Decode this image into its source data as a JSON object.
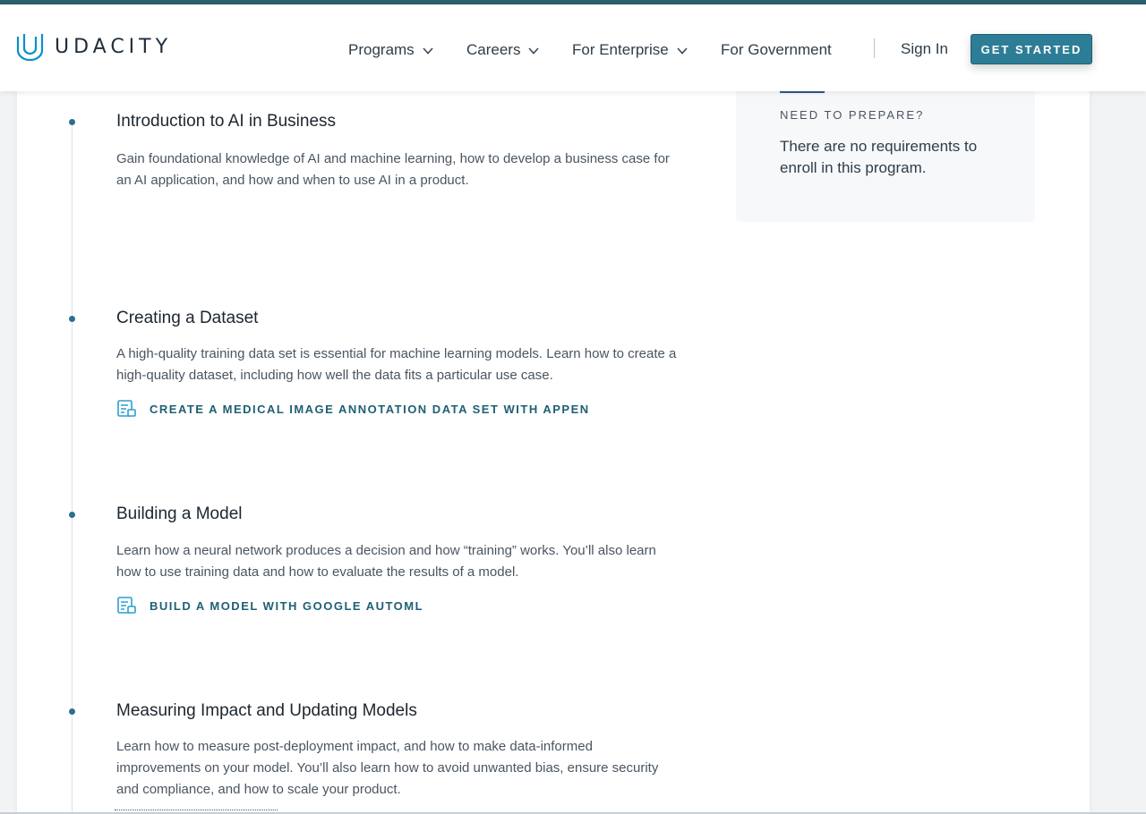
{
  "brand": {
    "name": "UDACITY",
    "accent_color": "#2e7d96",
    "top_strip_color": "#2a5f6e"
  },
  "nav": {
    "items": [
      {
        "label": "Programs",
        "has_dropdown": true
      },
      {
        "label": "Careers",
        "has_dropdown": true
      },
      {
        "label": "For Enterprise",
        "has_dropdown": true
      },
      {
        "label": "For Government",
        "has_dropdown": false
      }
    ],
    "sign_in": "Sign In",
    "cta": "GET STARTED"
  },
  "lessons": [
    {
      "title": "Introduction to AI in Business",
      "description": "Gain foundational knowledge of AI and machine learning, how to develop a business case for an AI application, and how and when to use AI in a product."
    },
    {
      "title": "Creating a Dataset",
      "description": "A high-quality training data set is essential for machine learning models. Learn how to create a high-quality dataset, including how well the data fits a particular use case.",
      "project": "CREATE A MEDICAL IMAGE ANNOTATION DATA SET WITH APPEN"
    },
    {
      "title": "Building a Model",
      "description": "Learn how a neural network produces a decision and how “training” works. You’ll also learn how to use training data and how to evaluate the results of a model.",
      "project": "BUILD A MODEL WITH GOOGLE AUTOML"
    },
    {
      "title": "Measuring Impact and Updating Models",
      "description": "Learn how to measure post-deployment impact, and how to make data-informed improvements on your model. You’ll also learn how to avoid unwanted bias, ensure security and compliance, and how to scale your product."
    }
  ],
  "prepare": {
    "heading": "NEED TO PREPARE?",
    "text": "There are no requirements to enroll in this program."
  }
}
